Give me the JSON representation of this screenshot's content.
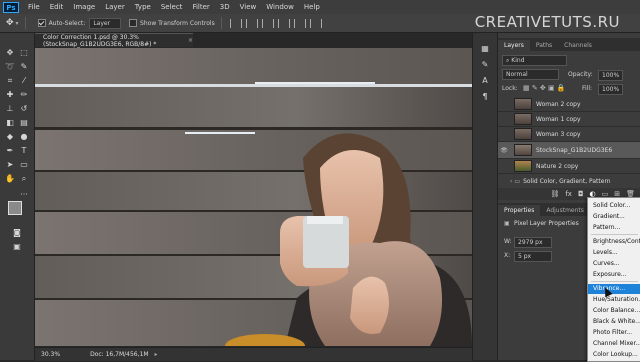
{
  "menubar": {
    "app_icon": "Ps",
    "items": [
      "File",
      "Edit",
      "Image",
      "Layer",
      "Type",
      "Select",
      "Filter",
      "3D",
      "View",
      "Window",
      "Help"
    ]
  },
  "options": {
    "auto_select_label": "Auto-Select:",
    "auto_select_value": "Layer",
    "transform_label": "Show Transform Controls"
  },
  "watermark": "CREATIVETUTS.RU",
  "document": {
    "tab_title": "Color Correction 1.psd @ 30.3% (StockSnap_G1B2UDG3E6, RGB/8#) *",
    "zoom": "30.3%",
    "doc_info": "Doc: 16,7M/456,1M"
  },
  "layers_panel": {
    "tabs": [
      "Layers",
      "Paths",
      "Channels"
    ],
    "kind_label": "Kind",
    "blend_mode": "Normal",
    "opacity_label": "Opacity:",
    "opacity_value": "100%",
    "lock_label": "Lock:",
    "fill_label": "Fill:",
    "fill_value": "100%",
    "layers": [
      {
        "name": "Woman 2 copy",
        "visible": false
      },
      {
        "name": "Woman 1 copy",
        "visible": false
      },
      {
        "name": "Woman 3 copy",
        "visible": false
      },
      {
        "name": "StockSnap_G1B2UDG3E6",
        "visible": true,
        "selected": true
      },
      {
        "name": "Nature 2 copy",
        "visible": false
      },
      {
        "name": "Solid Color, Gradient, Pattern",
        "visible": false,
        "group": true
      }
    ]
  },
  "properties_panel": {
    "tabs": [
      "Properties",
      "Adjustments"
    ],
    "title": "Pixel Layer Properties",
    "w_label": "W:",
    "w_value": "2979 px",
    "x_label": "X:",
    "x_value": "5 px"
  },
  "adjustment_menu": {
    "items": [
      "Solid Color...",
      "Gradient...",
      "Pattern...",
      "Brightness/Contrast...",
      "Levels...",
      "Curves...",
      "Exposure...",
      "Vibrance...",
      "Hue/Saturation...",
      "Color Balance...",
      "Black & White...",
      "Photo Filter...",
      "Channel Mixer...",
      "Color Lookup..."
    ],
    "highlighted": "Vibrance..."
  }
}
